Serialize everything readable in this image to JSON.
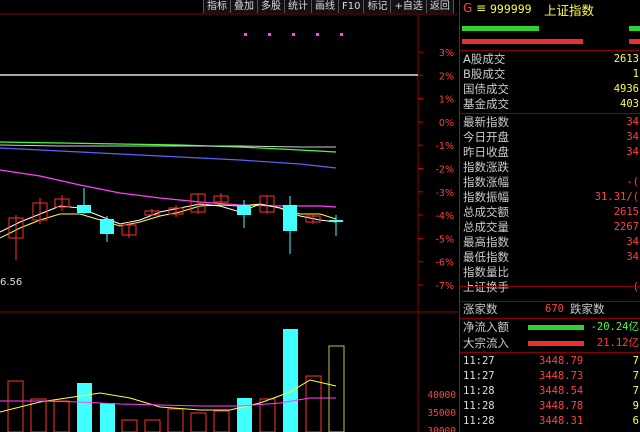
{
  "toolbar": {
    "items": [
      "指标",
      "叠加",
      "多股",
      "统计",
      "画线",
      "F10",
      "标记",
      "+自选",
      "返回"
    ]
  },
  "chart": {
    "pct_ticks": [
      "3%",
      "2%",
      "1%",
      "0%",
      "-1%",
      "-2%",
      "-3%",
      "-4%",
      "-5%",
      "-6%",
      "-7%"
    ],
    "low_label": "6.56",
    "vol_ticks": [
      "40000",
      "35000",
      "30000"
    ],
    "colors": {
      "up": "#ff3030",
      "down": "#40ffff",
      "ma5": "#ffffff",
      "ma10": "#ffff40",
      "ma20": "#ff40ff",
      "ma30": "#40ff40",
      "ma60": "#6060ff"
    }
  },
  "quote": {
    "market_letter": "G",
    "menu_icon": "menu-icon",
    "code": "999999",
    "name": "上证指数"
  },
  "stats": [
    {
      "label": "A股成交",
      "value": "2613"
    },
    {
      "label": "B股成交",
      "value": "1"
    },
    {
      "label": "国债成交",
      "value": "4936"
    },
    {
      "label": "基金成交",
      "value": "403"
    },
    {
      "label": "最新指数",
      "value": "34"
    },
    {
      "label": "今日开盘",
      "value": "34"
    },
    {
      "label": "昨日收盘",
      "value": "34"
    },
    {
      "label": "指数涨跌",
      "value": ""
    },
    {
      "label": "指数涨幅",
      "value": "-("
    },
    {
      "label": "指数振幅",
      "value": "31.31/("
    },
    {
      "label": "总成交额",
      "value": "2615"
    },
    {
      "label": "总成交量",
      "value": "2267"
    },
    {
      "label": "最高指数",
      "value": "34"
    },
    {
      "label": "最低指数",
      "value": "34"
    },
    {
      "label": "指数量比",
      "value": ""
    },
    {
      "label": "上证换手",
      "value": "("
    }
  ],
  "breadth": {
    "up_label": "涨家数",
    "up_value": "670",
    "down_label": "跌家数"
  },
  "flows": [
    {
      "label": "净流入额",
      "value": "-20.24亿"
    },
    {
      "label": "大宗流入",
      "value": "21.12亿"
    }
  ],
  "ticks": [
    {
      "time": "11:27",
      "price": "3448.79",
      "vol": "7"
    },
    {
      "time": "11:27",
      "price": "3448.73",
      "vol": "7"
    },
    {
      "time": "11:28",
      "price": "3448.54",
      "vol": "7"
    },
    {
      "time": "11:28",
      "price": "3448.78",
      "vol": "9"
    },
    {
      "time": "11:28",
      "price": "3448.31",
      "vol": "6"
    }
  ]
}
